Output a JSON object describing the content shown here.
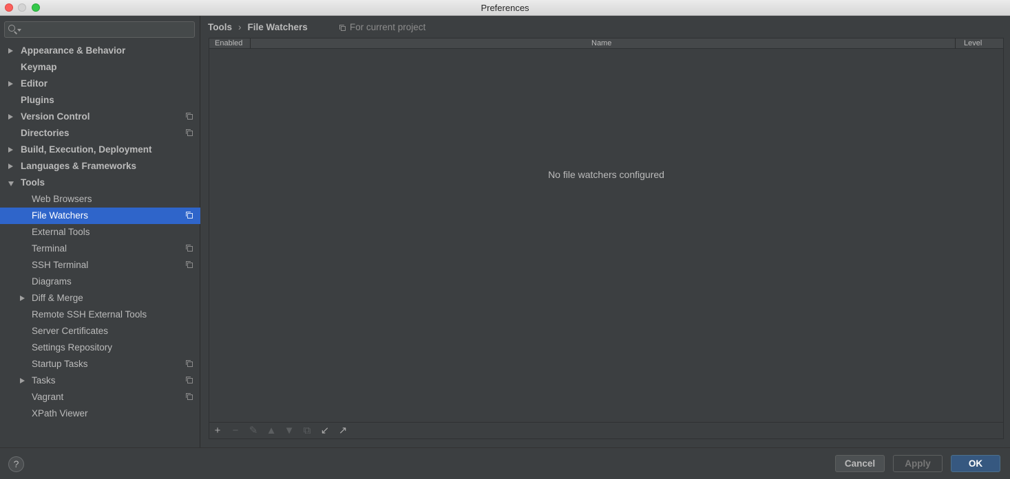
{
  "window": {
    "title": "Preferences"
  },
  "search": {
    "value": "",
    "placeholder": ""
  },
  "sidebar": {
    "items": [
      {
        "label": "Appearance & Behavior",
        "level": 0,
        "arrow": "right",
        "project": false,
        "selected": false
      },
      {
        "label": "Keymap",
        "level": 0,
        "arrow": "",
        "project": false,
        "selected": false
      },
      {
        "label": "Editor",
        "level": 0,
        "arrow": "right",
        "project": false,
        "selected": false
      },
      {
        "label": "Plugins",
        "level": 0,
        "arrow": "",
        "project": false,
        "selected": false
      },
      {
        "label": "Version Control",
        "level": 0,
        "arrow": "right",
        "project": true,
        "selected": false
      },
      {
        "label": "Directories",
        "level": 0,
        "arrow": "",
        "project": true,
        "selected": false
      },
      {
        "label": "Build, Execution, Deployment",
        "level": 0,
        "arrow": "right",
        "project": false,
        "selected": false
      },
      {
        "label": "Languages & Frameworks",
        "level": 0,
        "arrow": "right",
        "project": false,
        "selected": false
      },
      {
        "label": "Tools",
        "level": 0,
        "arrow": "down",
        "project": false,
        "selected": false
      },
      {
        "label": "Web Browsers",
        "level": 1,
        "arrow": "",
        "project": false,
        "selected": false
      },
      {
        "label": "File Watchers",
        "level": 1,
        "arrow": "",
        "project": true,
        "selected": true
      },
      {
        "label": "External Tools",
        "level": 1,
        "arrow": "",
        "project": false,
        "selected": false
      },
      {
        "label": "Terminal",
        "level": 1,
        "arrow": "",
        "project": true,
        "selected": false
      },
      {
        "label": "SSH Terminal",
        "level": 1,
        "arrow": "",
        "project": true,
        "selected": false
      },
      {
        "label": "Diagrams",
        "level": 1,
        "arrow": "",
        "project": false,
        "selected": false
      },
      {
        "label": "Diff & Merge",
        "level": 1,
        "arrow": "right",
        "project": false,
        "selected": false
      },
      {
        "label": "Remote SSH External Tools",
        "level": 1,
        "arrow": "",
        "project": false,
        "selected": false
      },
      {
        "label": "Server Certificates",
        "level": 1,
        "arrow": "",
        "project": false,
        "selected": false
      },
      {
        "label": "Settings Repository",
        "level": 1,
        "arrow": "",
        "project": false,
        "selected": false
      },
      {
        "label": "Startup Tasks",
        "level": 1,
        "arrow": "",
        "project": true,
        "selected": false
      },
      {
        "label": "Tasks",
        "level": 1,
        "arrow": "right",
        "project": true,
        "selected": false
      },
      {
        "label": "Vagrant",
        "level": 1,
        "arrow": "",
        "project": true,
        "selected": false
      },
      {
        "label": "XPath Viewer",
        "level": 1,
        "arrow": "",
        "project": false,
        "selected": false
      }
    ]
  },
  "main": {
    "breadcrumb": [
      "Tools",
      "File Watchers"
    ],
    "breadcrumb_separator": "›",
    "scope_label": "For current project",
    "table": {
      "columns": [
        "Enabled",
        "Name",
        "Level"
      ],
      "rows": [],
      "empty_text": "No file watchers configured"
    },
    "toolbar": [
      {
        "icon": "add-icon",
        "glyph": "+",
        "enabled": true
      },
      {
        "icon": "remove-icon",
        "glyph": "−",
        "enabled": false
      },
      {
        "icon": "edit-icon",
        "glyph": "✎",
        "enabled": false
      },
      {
        "icon": "move-up-icon",
        "glyph": "▲",
        "enabled": false
      },
      {
        "icon": "move-down-icon",
        "glyph": "▼",
        "enabled": false
      },
      {
        "icon": "copy-icon",
        "glyph": "⧉",
        "enabled": false
      },
      {
        "icon": "import-icon",
        "glyph": "↙",
        "enabled": true
      },
      {
        "icon": "export-icon",
        "glyph": "↗",
        "enabled": true
      }
    ]
  },
  "footer": {
    "help_label": "?",
    "cancel_label": "Cancel",
    "apply_label": "Apply",
    "ok_label": "OK"
  },
  "colors": {
    "background": "#3c3f41",
    "selection": "#2f65ca",
    "ok_button": "#365880",
    "text": "#bbbbbb"
  }
}
